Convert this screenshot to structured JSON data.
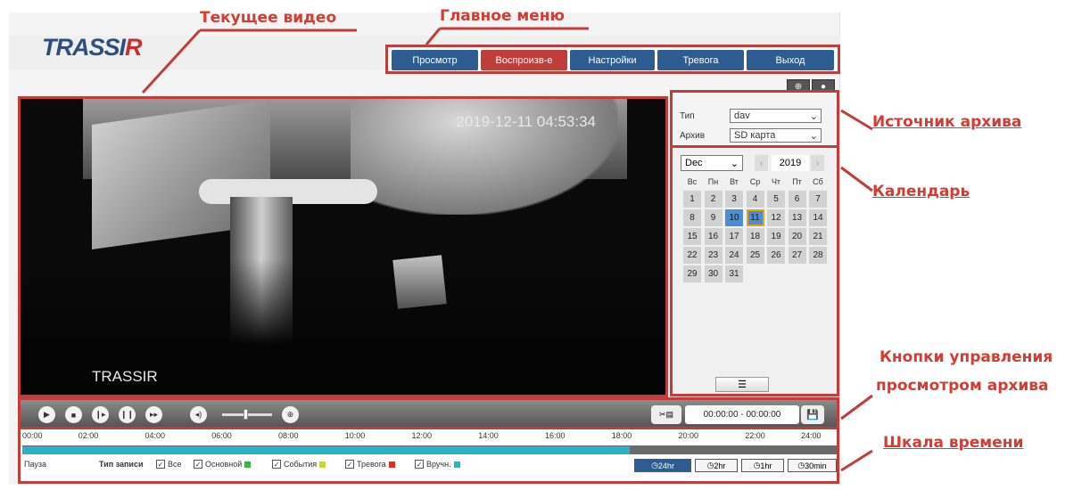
{
  "annotations": {
    "current_video": "Текущее видео",
    "main_menu": "Главное меню",
    "archive_source": "Источник архива",
    "calendar": "Календарь",
    "controls_line1": "Кнопки управления",
    "controls_line2": "просмотром архива",
    "timeline": "Шкала времени"
  },
  "logo": {
    "text_main": "TRASSI",
    "text_r": "R"
  },
  "menu": {
    "items": [
      {
        "label": "Просмотр",
        "active": false
      },
      {
        "label": "Воспроизв-е",
        "active": true
      },
      {
        "label": "Настройки",
        "active": false
      },
      {
        "label": "Тревога",
        "active": false
      },
      {
        "label": "Выход",
        "active": false
      }
    ]
  },
  "video": {
    "timestamp": "2019-12-11 04:53:34",
    "channel_name": "TRASSIR"
  },
  "source": {
    "type_label": "Тип",
    "type_value": "dav",
    "archive_label": "Архив",
    "archive_value": "SD карта"
  },
  "calendar": {
    "month": "Dec",
    "year": "2019",
    "weekdays": [
      "Вс",
      "Пн",
      "Вт",
      "Ср",
      "Чт",
      "Пт",
      "Сб"
    ],
    "days": [
      "1",
      "2",
      "3",
      "4",
      "5",
      "6",
      "7",
      "8",
      "9",
      "10",
      "11",
      "12",
      "13",
      "14",
      "15",
      "16",
      "17",
      "18",
      "19",
      "20",
      "21",
      "22",
      "23",
      "24",
      "25",
      "26",
      "27",
      "28",
      "29",
      "30",
      "31"
    ],
    "selected_day": "10",
    "today": "11"
  },
  "controls": {
    "time_range": "00:00:00 - 00:00:00"
  },
  "timeline": {
    "ticks": [
      "00:00",
      "02:00",
      "04:00",
      "06:00",
      "08:00",
      "10:00",
      "12:00",
      "14:00",
      "16:00",
      "18:00",
      "20:00",
      "22:00",
      "24:00"
    ],
    "pause_label": "Пауза",
    "record_type_label": "Тип записи",
    "filters": [
      {
        "label": "Все",
        "color": ""
      },
      {
        "label": "Основной",
        "color": "#3cb34a"
      },
      {
        "label": "События",
        "color": "#c9d23c"
      },
      {
        "label": "Тревога",
        "color": "#d4302d"
      },
      {
        "label": "Вручн.",
        "color": "#2cb2c8"
      }
    ],
    "zoom": [
      {
        "label": "24hr",
        "active": true
      },
      {
        "label": "2hr",
        "active": false
      },
      {
        "label": "1hr",
        "active": false
      },
      {
        "label": "30min",
        "active": false
      }
    ]
  }
}
